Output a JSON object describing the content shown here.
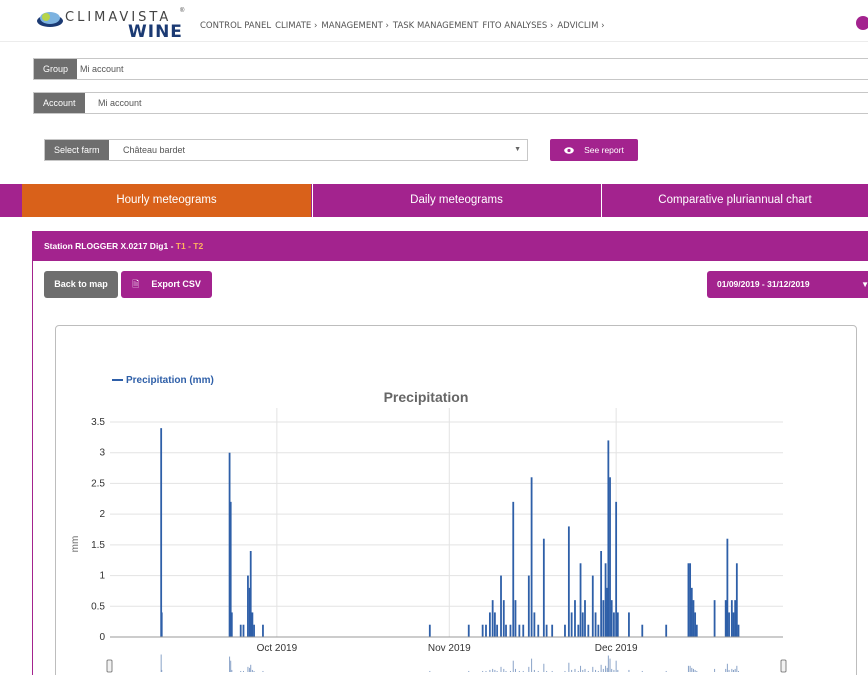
{
  "header": {
    "brand": "CLIMAVISTA",
    "brand_sub": "WINE",
    "trademark": "®",
    "nav": [
      "CONTROL PANEL",
      "CLIMATE ›",
      "MANAGEMENT ›",
      "TASK MANAGEMENT",
      "FITO ANALYSES ›",
      "ADVICLIM ›"
    ]
  },
  "form": {
    "group_label": "Group",
    "group_value": "Mi account",
    "account_label": "Account",
    "account_value": "Mi account",
    "farm_label": "Select farm",
    "farm_value": "Château bardet",
    "see_report": "See report"
  },
  "tabs": [
    {
      "label": "Hourly meteograms",
      "active": true
    },
    {
      "label": "Daily meteograms",
      "active": false
    },
    {
      "label": "Comparative pluriannual chart",
      "active": false
    }
  ],
  "station": {
    "title": "Station RLOGGER X.0217 Dig1 - ",
    "t1": "T1",
    "sep": " - ",
    "t2": "T2",
    "back_label": "Back to map",
    "export_label": "Export CSV",
    "date_range": "01/09/2019 - 31/12/2019"
  },
  "colors": {
    "accent": "#a3238e",
    "active_tab": "#d9611a",
    "series": "#2e5fa8",
    "highlight": "#ffb25e"
  },
  "chart_data": {
    "type": "bar",
    "title": "Precipitation",
    "ylabel": "mm",
    "ylim": [
      0,
      3.5
    ],
    "yticks": [
      "0",
      "0.5",
      "1",
      "1.5",
      "2",
      "2.5",
      "3",
      "3.5"
    ],
    "xticks": [
      "Oct 2019",
      "Nov 2019",
      "Dec 2019"
    ],
    "xtick_days": [
      30,
      61,
      91
    ],
    "grid": true,
    "legend": "top-left",
    "series": [
      {
        "name": "Precipitation (mm)",
        "points": [
          [
            9.2,
            3.4
          ],
          [
            9.3,
            0.4
          ],
          [
            21.5,
            3.0
          ],
          [
            21.7,
            2.2
          ],
          [
            21.9,
            0.4
          ],
          [
            23.5,
            0.2
          ],
          [
            24.0,
            0.2
          ],
          [
            24.8,
            1.0
          ],
          [
            25.1,
            0.8
          ],
          [
            25.3,
            1.4
          ],
          [
            25.6,
            0.4
          ],
          [
            25.9,
            0.2
          ],
          [
            27.5,
            0.2
          ],
          [
            57.5,
            0.2
          ],
          [
            64.5,
            0.2
          ],
          [
            67.0,
            0.2
          ],
          [
            67.6,
            0.2
          ],
          [
            68.3,
            0.4
          ],
          [
            68.8,
            0.6
          ],
          [
            69.2,
            0.4
          ],
          [
            69.6,
            0.2
          ],
          [
            70.3,
            1.0
          ],
          [
            70.8,
            0.6
          ],
          [
            71.2,
            0.2
          ],
          [
            72.0,
            0.2
          ],
          [
            72.5,
            2.2
          ],
          [
            72.9,
            0.6
          ],
          [
            73.6,
            0.2
          ],
          [
            74.3,
            0.2
          ],
          [
            75.3,
            1.0
          ],
          [
            75.8,
            2.6
          ],
          [
            76.3,
            0.4
          ],
          [
            77.0,
            0.2
          ],
          [
            78.0,
            1.6
          ],
          [
            78.5,
            0.2
          ],
          [
            79.5,
            0.2
          ],
          [
            81.8,
            0.2
          ],
          [
            82.5,
            1.8
          ],
          [
            83.0,
            0.4
          ],
          [
            83.6,
            0.6
          ],
          [
            84.2,
            0.2
          ],
          [
            84.6,
            1.2
          ],
          [
            85.0,
            0.4
          ],
          [
            85.4,
            0.6
          ],
          [
            86.0,
            0.2
          ],
          [
            86.8,
            1.0
          ],
          [
            87.3,
            0.4
          ],
          [
            87.8,
            0.2
          ],
          [
            88.3,
            1.4
          ],
          [
            88.7,
            0.6
          ],
          [
            89.1,
            1.2
          ],
          [
            89.4,
            0.8
          ],
          [
            89.6,
            3.2
          ],
          [
            89.9,
            2.6
          ],
          [
            90.2,
            0.6
          ],
          [
            90.6,
            0.4
          ],
          [
            91.0,
            2.2
          ],
          [
            91.3,
            0.4
          ],
          [
            93.3,
            0.4
          ],
          [
            95.7,
            0.2
          ],
          [
            100.0,
            0.2
          ],
          [
            104.0,
            1.2
          ],
          [
            104.3,
            1.2
          ],
          [
            104.6,
            0.8
          ],
          [
            104.9,
            0.6
          ],
          [
            105.2,
            0.4
          ],
          [
            105.5,
            0.2
          ],
          [
            108.7,
            0.6
          ],
          [
            110.7,
            0.6
          ],
          [
            111.0,
            1.6
          ],
          [
            111.3,
            0.4
          ],
          [
            111.8,
            0.6
          ],
          [
            112.1,
            0.4
          ],
          [
            112.4,
            0.6
          ],
          [
            112.7,
            1.2
          ],
          [
            113.0,
            0.2
          ]
        ]
      }
    ]
  }
}
